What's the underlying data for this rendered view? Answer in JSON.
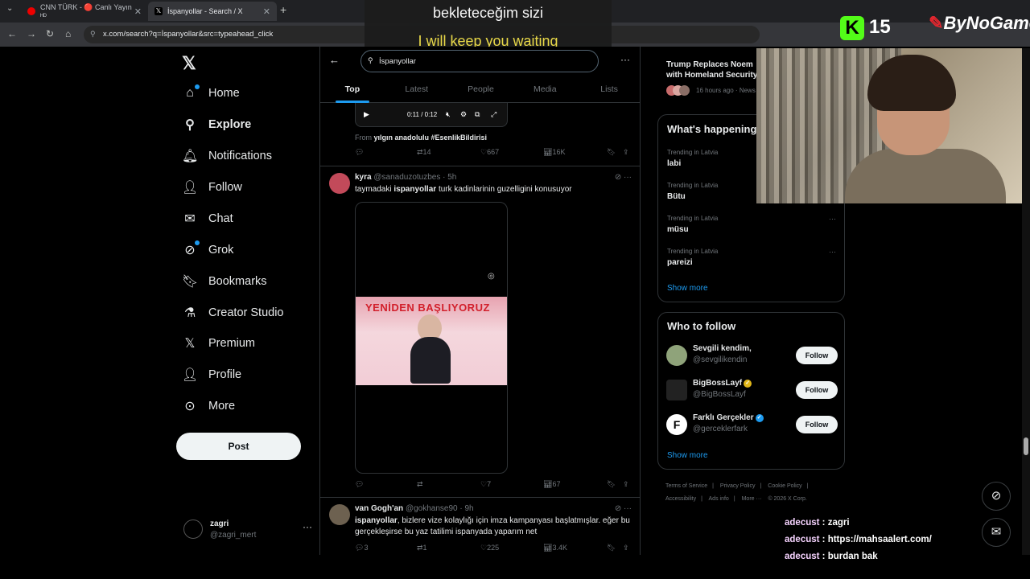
{
  "browser": {
    "tabs": [
      {
        "label": "CNN TÜRK - 🔴 Canlı Yayın ᴴᴰ",
        "active": false
      },
      {
        "label": "İspanyollar - Search / X",
        "active": true
      }
    ],
    "new_tab": "+",
    "url": "x.com/search?q=İspanyollar&src=typeahead_click"
  },
  "captions": {
    "line1": "bekleteceğim sizi",
    "line2": "I will keep you waiting"
  },
  "stream": {
    "kick_logo": "K",
    "viewer_count": "15",
    "brand": "ByNoGame"
  },
  "nav": {
    "items": [
      {
        "label": "Home",
        "icon": "home-icon"
      },
      {
        "label": "Explore",
        "icon": "search-icon"
      },
      {
        "label": "Notifications",
        "icon": "bell-icon"
      },
      {
        "label": "Follow",
        "icon": "add-person-icon"
      },
      {
        "label": "Chat",
        "icon": "mail-icon"
      },
      {
        "label": "Grok",
        "icon": "grok-icon"
      },
      {
        "label": "Bookmarks",
        "icon": "bookmark-icon"
      },
      {
        "label": "Creator Studio",
        "icon": "flask-icon"
      },
      {
        "label": "Premium",
        "icon": "x-logo-icon"
      },
      {
        "label": "Profile",
        "icon": "person-icon"
      },
      {
        "label": "More",
        "icon": "more-circle-icon"
      }
    ],
    "post_button": "Post",
    "account": {
      "name": "zagri",
      "handle": "@zagri_mert"
    }
  },
  "search": {
    "query": "İspanyollar",
    "tabs": [
      "Top",
      "Latest",
      "People",
      "Media",
      "Lists"
    ]
  },
  "posts": [
    {
      "video_time": "0:11 / 0:12",
      "from_label": "From",
      "from_text": "yılgın anadolulu #EsenlikBildirisi",
      "replies": "",
      "reposts": "14",
      "likes": "667",
      "views": "16K"
    },
    {
      "name": "kyra",
      "handle": "@sanaduzotuzbes",
      "time": "5h",
      "text_bold": "ispanyollar",
      "text_pre": "taymadaki ",
      "text_post": " turk kadinlarinin guzelligini konusuyor",
      "media_banner": "YENİDEN BAŞLIYORUZ",
      "replies": "",
      "reposts": "",
      "likes": "7",
      "views": "67"
    },
    {
      "name": "van Gogh'an",
      "handle": "@gokhanse90",
      "time": "9h",
      "text_bold": "ispanyollar",
      "text_post": ", bizlere vize kolaylığı için imza kampanyası başlatmışlar. eğer bu gerçekleşirse bu yaz tatilimi ispanyada yaparım net",
      "replies": "3",
      "reposts": "1",
      "likes": "225",
      "views": "3.4K"
    }
  ],
  "news": {
    "title": "Trump Replaces Noem with Homeland Security",
    "meta": "16 hours ago · News"
  },
  "trending": {
    "title": "What's happening",
    "items": [
      {
        "context": "Trending in Latvia",
        "name": "labi"
      },
      {
        "context": "Trending in Latvia",
        "name": "Bütu"
      },
      {
        "context": "Trending in Latvia",
        "name": "müsu"
      },
      {
        "context": "Trending in Latvia",
        "name": "pareizi"
      }
    ],
    "show_more": "Show more"
  },
  "who_to_follow": {
    "title": "Who to follow",
    "items": [
      {
        "name": "Sevgili kendim,",
        "handle": "@sevgilikendin",
        "verified": false,
        "avatar_color": "#8fa37a"
      },
      {
        "name": "BigBossLayf",
        "handle": "@BigBossLayf",
        "verified": true,
        "badge_color": "#e2b719",
        "avatar_color": "#222222"
      },
      {
        "name": "Farklı Gerçekler",
        "handle": "@gerceklerfark",
        "verified": true,
        "badge_color": "#1d9bf0",
        "avatar_color": "#ffffff"
      }
    ],
    "follow_label": "Follow",
    "show_more": "Show more"
  },
  "footer": [
    "Terms of Service",
    "|",
    "Privacy Policy",
    "|",
    "Cookie Policy",
    "|",
    "Accessibility",
    "|",
    "Ads info",
    "|",
    "More ···",
    "© 2026 X Corp."
  ],
  "chat": [
    {
      "user": "adecust",
      "message": "zagri"
    },
    {
      "user": "adecust",
      "message": "https://mahsaalert.com/"
    },
    {
      "user": "adecust",
      "message": "burdan bak"
    }
  ],
  "colors": {
    "accent": "#1d9bf0",
    "kick": "#53fc18",
    "brand_red": "#e3262e"
  }
}
